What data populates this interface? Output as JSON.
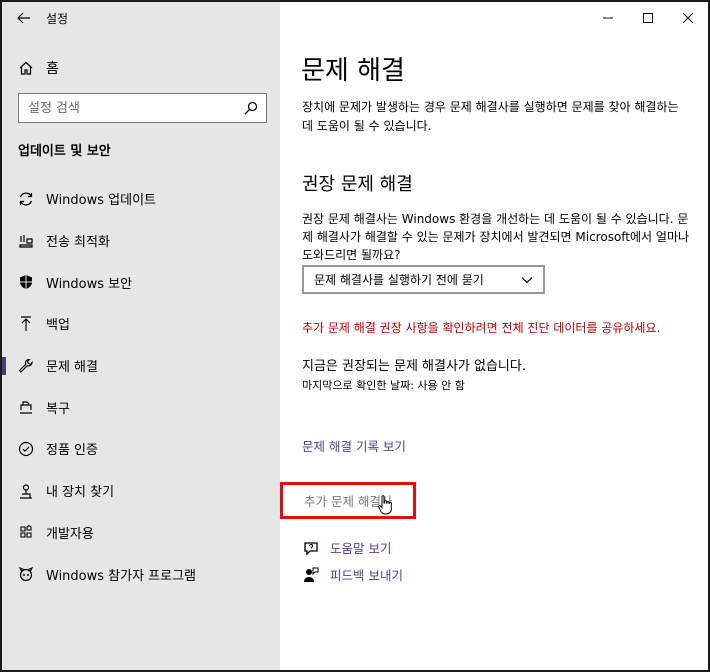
{
  "window": {
    "title": "설정"
  },
  "sidebar": {
    "home_label": "홈",
    "search_placeholder": "설정 검색",
    "section_title": "업데이트 및 보안",
    "items": [
      {
        "label": "Windows 업데이트",
        "icon": "refresh-icon"
      },
      {
        "label": "전송 최적화",
        "icon": "delivery-optimization-icon"
      },
      {
        "label": "Windows 보안",
        "icon": "shield-icon"
      },
      {
        "label": "백업",
        "icon": "backup-arrow-icon"
      },
      {
        "label": "문제 해결",
        "icon": "wrench-icon",
        "active": true
      },
      {
        "label": "복구",
        "icon": "recovery-icon"
      },
      {
        "label": "정품 인증",
        "icon": "activation-check-icon"
      },
      {
        "label": "내 장치 찾기",
        "icon": "find-device-icon"
      },
      {
        "label": "개발자용",
        "icon": "developer-icon"
      },
      {
        "label": "Windows 참가자 프로그램",
        "icon": "insider-icon"
      }
    ]
  },
  "main": {
    "title": "문제 해결",
    "intro": "장치에 문제가 발생하는 경우 문제 해결사를 실행하면 문제를 찾아 해결하는 데 도움이 될 수 있습니다.",
    "recommended_heading": "권장 문제 해결",
    "recommended_desc": "권장 문제 해결사는 Windows 환경을 개선하는 데 도움이 될 수 있습니다. 문제 해결사가 해결할 수 있는 문제가 장치에서 발견되면 Microsoft에서 얼마나 도와드리면 될까요?",
    "dropdown_value": "문제 해결사를 실행하기 전에 묻기",
    "warning": "추가 문제 해결 권장 사항을 확인하려면 전체 진단 데이터를 공유하세요.",
    "none_message": "지금은 권장되는 문제 해결사가 없습니다.",
    "last_checked": "마지막으로 확인한 날짜: 사용 안 함",
    "history_link": "문제 해결 기록 보기",
    "additional_troubleshooters": "추가 문제 해결사",
    "help_link": "도움말 보기",
    "feedback_link": "피드백 보내기"
  },
  "colors": {
    "sidebar_bg": "#e6e6e6",
    "accent": "#5a3f8a",
    "warning": "#c00000",
    "highlight_box": "#e01010"
  }
}
